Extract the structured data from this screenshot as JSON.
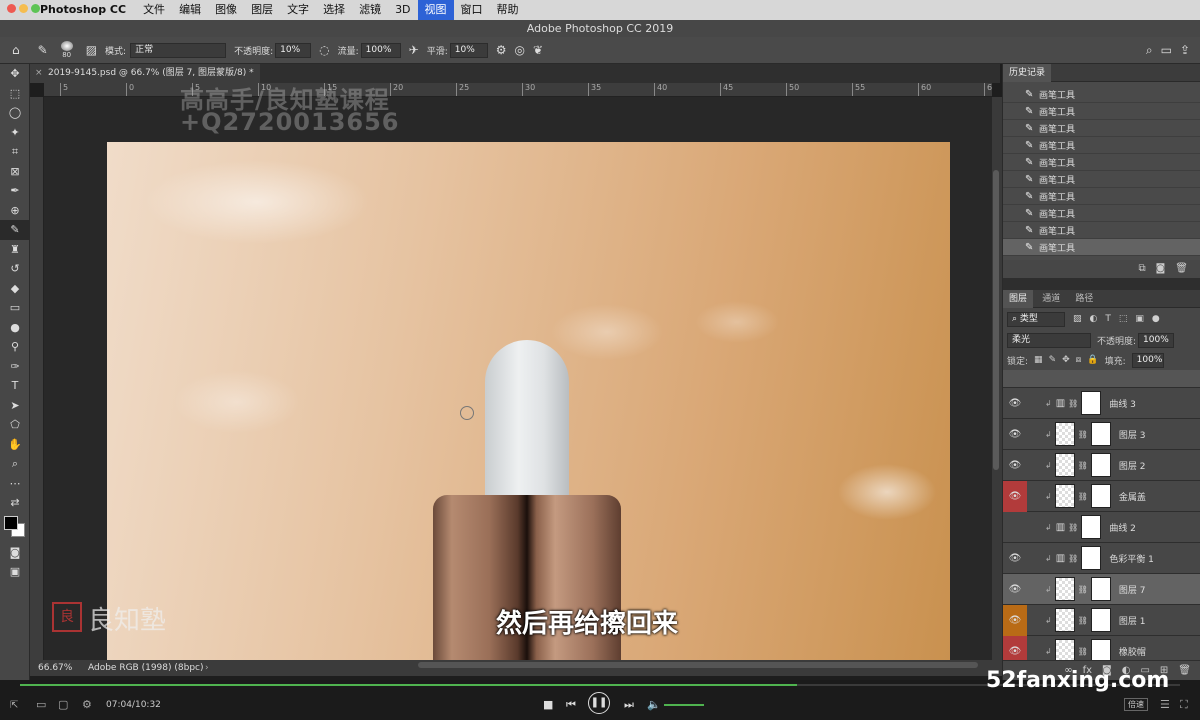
{
  "menubar": {
    "app": "Photoshop CC",
    "items": [
      "文件",
      "编辑",
      "图像",
      "图层",
      "文字",
      "选择",
      "滤镜",
      "3D",
      "视图",
      "窗口",
      "帮助"
    ],
    "active": "视图"
  },
  "window": {
    "title": "Adobe Photoshop CC 2019"
  },
  "options": {
    "brush_size": "80",
    "mode_label": "模式:",
    "mode_value": "正常",
    "opacity_label": "不透明度:",
    "opacity_value": "10%",
    "flow_label": "流量:",
    "flow_value": "100%",
    "smooth_label": "平滑:",
    "smooth_value": "10%"
  },
  "document": {
    "tab": "2019-9145.psd @ 66.7% (图层 7, 图层蒙版/8) *",
    "zoom": "66.67%",
    "profile": "Adobe RGB (1998) (8bpc)"
  },
  "ruler": {
    "labels": [
      "5",
      "0",
      "5",
      "10",
      "15",
      "20",
      "25",
      "30",
      "35",
      "40",
      "45",
      "50",
      "55",
      "60",
      "65",
      "70",
      "75",
      "80"
    ]
  },
  "watermark": {
    "line1": "高高手/良知塾课程",
    "line2": "+Q2720013656"
  },
  "canvas": {
    "logo_seal": "良",
    "logo_text": "良知塾",
    "subtitle": "然后再给擦回来"
  },
  "history": {
    "title": "历史记录",
    "items": [
      "画笔工具",
      "画笔工具",
      "画笔工具",
      "画笔工具",
      "画笔工具",
      "画笔工具",
      "画笔工具",
      "画笔工具",
      "画笔工具",
      "画笔工具"
    ]
  },
  "layers_panel": {
    "tabs": [
      "图层",
      "通道",
      "路径"
    ],
    "filter": "类型",
    "blend": "柔光",
    "opacity_label": "不透明度:",
    "opacity": "100%",
    "lock_label": "锁定:",
    "fill_label": "填充:",
    "fill": "100%",
    "layers": [
      {
        "name": "曲线 3",
        "eye": true,
        "color": "none",
        "adjust": true,
        "selected": false
      },
      {
        "name": "图层 3",
        "eye": true,
        "color": "none",
        "adjust": false,
        "selected": false
      },
      {
        "name": "图层 2",
        "eye": true,
        "color": "none",
        "adjust": false,
        "selected": false
      },
      {
        "name": "金属盖",
        "eye": true,
        "color": "red",
        "adjust": false,
        "selected": false
      },
      {
        "name": "曲线 2",
        "eye": false,
        "color": "none",
        "adjust": true,
        "selected": false
      },
      {
        "name": "色彩平衡 1",
        "eye": true,
        "color": "none",
        "adjust": true,
        "selected": false
      },
      {
        "name": "图层 7",
        "eye": true,
        "color": "none",
        "adjust": false,
        "selected": true
      },
      {
        "name": "图层 1",
        "eye": true,
        "color": "orange",
        "adjust": false,
        "selected": false
      },
      {
        "name": "橡胶帽",
        "eye": true,
        "color": "red",
        "adjust": false,
        "selected": false
      }
    ]
  },
  "player": {
    "time": "07:04/10:32",
    "progress": 0.67,
    "speed": "倍速"
  },
  "brand": "52fanxing.com"
}
